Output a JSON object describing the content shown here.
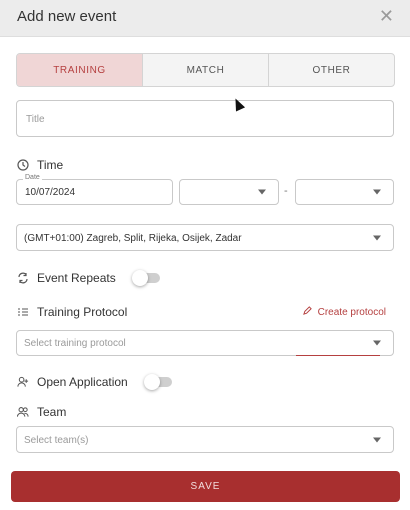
{
  "dialog": {
    "title": "Add new event"
  },
  "tabs": [
    {
      "label": "TRAINING",
      "active": true
    },
    {
      "label": "MATCH",
      "active": false
    },
    {
      "label": "OTHER",
      "active": false
    }
  ],
  "title_field": {
    "placeholder": "Title"
  },
  "time": {
    "label": "Time",
    "date_label": "Date",
    "date_value": "10/07/2024",
    "separator": "-"
  },
  "timezone": {
    "value": "(GMT+01:00) Zagreb, Split, Rijeka, Osijek, Zadar"
  },
  "event_repeats": {
    "label": "Event Repeats",
    "enabled": false
  },
  "training_protocol": {
    "label": "Training Protocol",
    "create_label": "Create protocol",
    "placeholder": "Select training protocol"
  },
  "open_application": {
    "label": "Open Application",
    "enabled": false
  },
  "team": {
    "label": "Team",
    "placeholder": "Select team(s)"
  },
  "save_label": "SAVE",
  "colors": {
    "accent": "#a82f2f",
    "tab_active_bg": "#f0d6d6",
    "tab_active_text": "#b54040"
  },
  "icons": {
    "close": "close-icon",
    "clock": "clock-icon",
    "repeat": "repeat-icon",
    "list": "list-icon",
    "pencil": "pencil-icon",
    "user_add": "user-add-icon",
    "team": "team-icon"
  }
}
